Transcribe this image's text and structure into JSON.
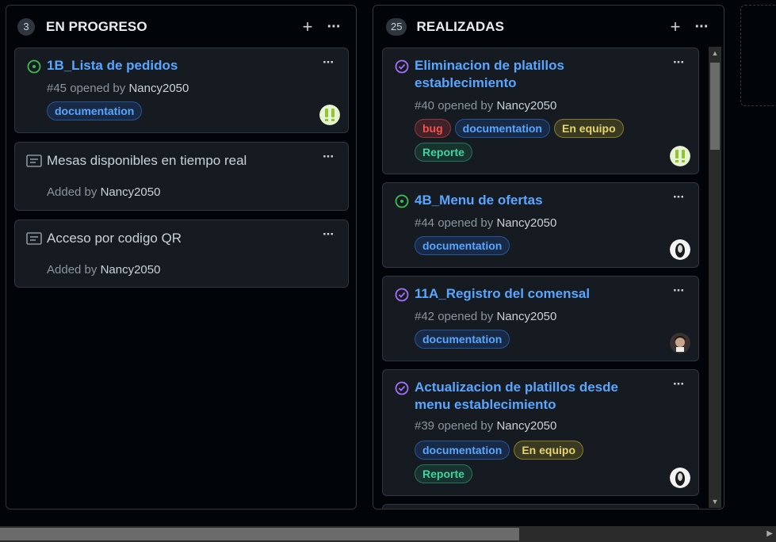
{
  "columns": [
    {
      "count": "3",
      "title": "EN PROGRESO",
      "cards": [
        {
          "kind": "issue",
          "state": "open",
          "title": "1B_Lista de pedidos",
          "number": "#45",
          "opened_by": "opened by",
          "author": "Nancy2050",
          "labels": [
            "documentation"
          ]
        },
        {
          "kind": "note",
          "title": "Mesas disponibles en tiempo real",
          "added_by": "Added by",
          "author": "Nancy2050"
        },
        {
          "kind": "note",
          "title": "Acceso por codigo QR",
          "added_by": "Added by",
          "author": "Nancy2050"
        }
      ]
    },
    {
      "count": "25",
      "title": "REALIZADAS",
      "cards": [
        {
          "kind": "issue",
          "state": "closed",
          "title": "Eliminacion de platillos establecimiento",
          "number": "#40",
          "opened_by": "opened by",
          "author": "Nancy2050",
          "labels": [
            "bug",
            "documentation",
            "En equipo",
            "Reporte"
          ]
        },
        {
          "kind": "issue",
          "state": "open",
          "title": "4B_Menu de ofertas",
          "number": "#44",
          "opened_by": "opened by",
          "author": "Nancy2050",
          "labels": [
            "documentation"
          ]
        },
        {
          "kind": "issue",
          "state": "closed",
          "title": "11A_Registro del comensal",
          "number": "#42",
          "opened_by": "opened by",
          "author": "Nancy2050",
          "labels": [
            "documentation"
          ]
        },
        {
          "kind": "issue",
          "state": "closed",
          "title": "Actualizacion de platillos desde menu establecimiento",
          "number": "#39",
          "opened_by": "opened by",
          "author": "Nancy2050",
          "labels": [
            "documentation",
            "En equipo",
            "Reporte"
          ]
        }
      ]
    }
  ],
  "icons": {
    "add": "plus-icon",
    "more": "kebab-icon",
    "open": "issue-opened-icon",
    "closed": "issue-closed-icon",
    "note": "note-icon"
  },
  "colors": {
    "open_state": "#3fb950",
    "closed_state": "#a371f7",
    "link": "#58a6ff",
    "background": "#010409",
    "card": "#161b22"
  },
  "controls": {
    "add": "+",
    "more": "···"
  }
}
